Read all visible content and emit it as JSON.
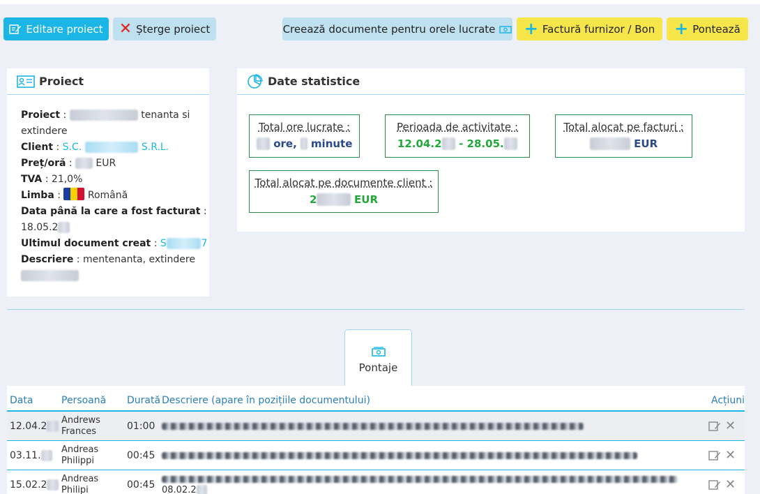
{
  "toolbar": {
    "edit_label": "Editare proiect",
    "delete_label": "Șterge proiect",
    "docs_label": "Creează documente pentru orele lucrate",
    "invoice_label": "Factură furnizor / Bon",
    "clock_label": "Pontează"
  },
  "project": {
    "title": "Proiect",
    "fields": {
      "proiect_label": "Proiect",
      "proiect_value_tail": "tenanta si",
      "proiect_value_line2": "extindere",
      "client_label": "Client",
      "client_prefix": "S.C.",
      "client_suffix": "S.R.L.",
      "price_label": "Preț/oră",
      "price_currency": "EUR",
      "tva_label": "TVA",
      "tva_value": "21,0%",
      "lang_label": "Limba",
      "lang_value": "Română",
      "invoiced_label": "Data până la care a fost facturat",
      "invoiced_value": "18.05.2",
      "last_doc_label": "Ultimul document creat",
      "last_doc_value": "S",
      "desc_label": "Descriere",
      "desc_value": "mentenanta, extindere"
    }
  },
  "stats": {
    "title": "Date statistice",
    "hours_label": "Total ore lucrate",
    "hours_mid": "ore,",
    "hours_tail": "minute",
    "period_label": "Perioada de activitate",
    "period_start": "12.04.2",
    "period_end": "- 28.05.",
    "invoices_label": "Total alocat pe facturi",
    "invoices_currency": "EUR",
    "client_docs_label": "Total alocat pe documente client",
    "client_docs_prefix": "2",
    "client_docs_currency": "EUR"
  },
  "tabs": {
    "pontaje_label": "Pontaje"
  },
  "table": {
    "columns": [
      "Data",
      "Persoană",
      "Durată",
      "Descriere (apare în pozițiile documentului)",
      "Acțiuni"
    ],
    "rows": [
      {
        "date": "12.04.2",
        "person_top": "Andrews",
        "person_bottom": "Frances",
        "duration": "01:00"
      },
      {
        "date": "03.11.",
        "person_top": "Andreas",
        "person_bottom": "Philippi",
        "duration": "00:45"
      },
      {
        "date": "15.02.2",
        "person_top": "Andreas",
        "person_bottom": "Philipi",
        "duration": "00:45",
        "desc_line2": "08.02.2"
      }
    ]
  },
  "colors": {
    "accent": "#1bb6e6",
    "yellow": "#f7e64a",
    "green": "#22a83a"
  }
}
